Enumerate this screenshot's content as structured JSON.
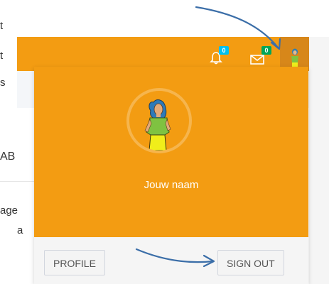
{
  "background": {
    "fragments": [
      "t",
      "t",
      "s",
      "AB",
      "age",
      "a"
    ]
  },
  "topbar": {
    "color": "#f39c12",
    "notifications": {
      "icon": "bell-icon",
      "count": "0",
      "badge_color": "#00c0ef"
    },
    "messages": {
      "icon": "envelope-icon",
      "count": "0",
      "badge_color": "#00a65a"
    },
    "user_icon": "user-avatar-icon"
  },
  "user_menu": {
    "header_color": "#f39c12",
    "name": "Jouw naam",
    "avatar_icon": "woman-avatar-icon",
    "profile_label": "PROFILE",
    "signout_label": "SIGN OUT"
  },
  "annotations": {
    "arrow_color": "#3b6ea8",
    "arrows": [
      "arrow-to-user-icon",
      "arrow-to-signout"
    ]
  }
}
